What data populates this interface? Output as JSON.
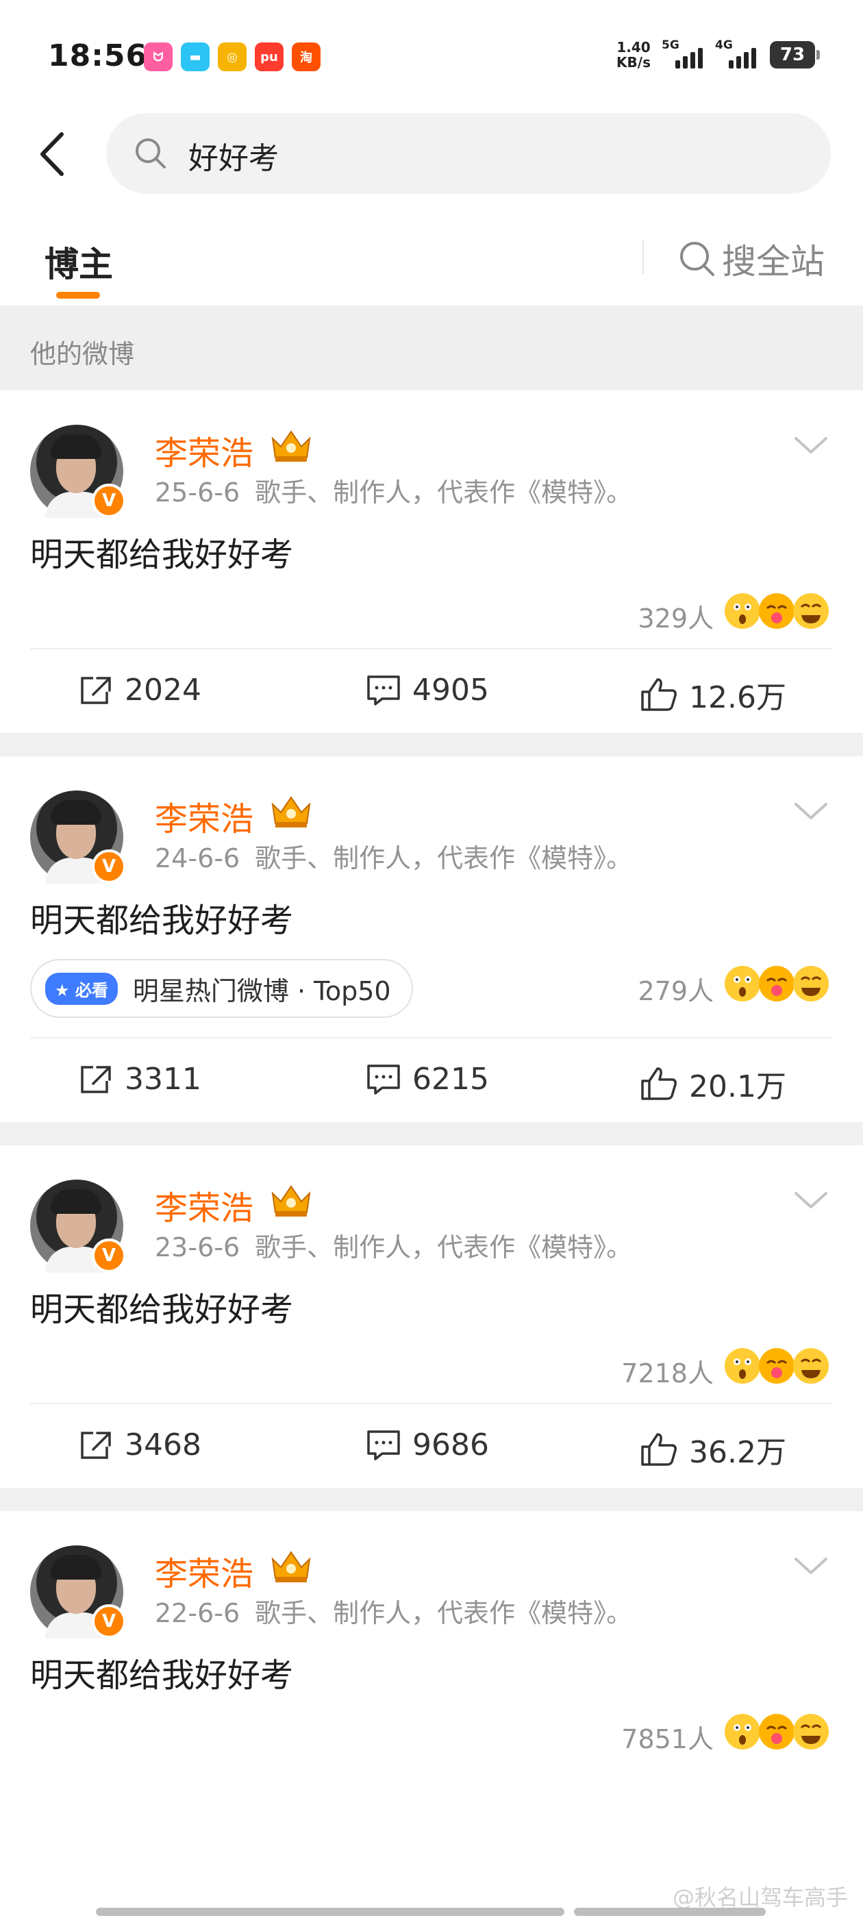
{
  "status_bar": {
    "time": "18:56",
    "apps": [
      {
        "icon": "bilibili-icon",
        "label": "ᗢ",
        "color": "#ff5fa0"
      },
      {
        "icon": "cloud-app-icon",
        "label": "▬",
        "color": "#2bc4f5"
      },
      {
        "icon": "weibo-icon",
        "label": "◎",
        "color": "#f6b400"
      },
      {
        "icon": "pdd-icon",
        "label": "pu",
        "color": "#ff3c2e"
      },
      {
        "icon": "taobao-icon",
        "label": "淘",
        "color": "#ff5000"
      }
    ],
    "speed_value": "1.40",
    "speed_unit": "KB/s",
    "net1": "5G",
    "net2": "4G",
    "battery": "73"
  },
  "search": {
    "query": "好好考"
  },
  "tabs": {
    "active": "博主",
    "search_all": "搜全站"
  },
  "section_title": "他的微博",
  "posts": [
    {
      "username": "李荣浩",
      "date": "25-6-6",
      "bio": "歌手、制作人，代表作《模特》。",
      "text": "明天都给我好好考",
      "hot_tag": null,
      "reactions": "329人",
      "shares": "2024",
      "comments": "4905",
      "likes": "12.6万"
    },
    {
      "username": "李荣浩",
      "date": "24-6-6",
      "bio": "歌手、制作人，代表作《模特》。",
      "text": "明天都给我好好考",
      "hot_tag": {
        "badge": "必看",
        "label": "明星热门微博 · Top50"
      },
      "reactions": "279人",
      "shares": "3311",
      "comments": "6215",
      "likes": "20.1万"
    },
    {
      "username": "李荣浩",
      "date": "23-6-6",
      "bio": "歌手、制作人，代表作《模特》。",
      "text": "明天都给我好好考",
      "hot_tag": null,
      "reactions": "7218人",
      "shares": "3468",
      "comments": "9686",
      "likes": "36.2万"
    },
    {
      "username": "李荣浩",
      "date": "22-6-6",
      "bio": "歌手、制作人，代表作《模特》。",
      "text": "明天都给我好好考",
      "hot_tag": null,
      "reactions": "7851人"
    }
  ],
  "watermark": "@秋名山驾车高手",
  "colors": {
    "accent": "#ff8200",
    "username": "#ff6a00",
    "meta": "#939393",
    "section_bg": "#efefef"
  }
}
